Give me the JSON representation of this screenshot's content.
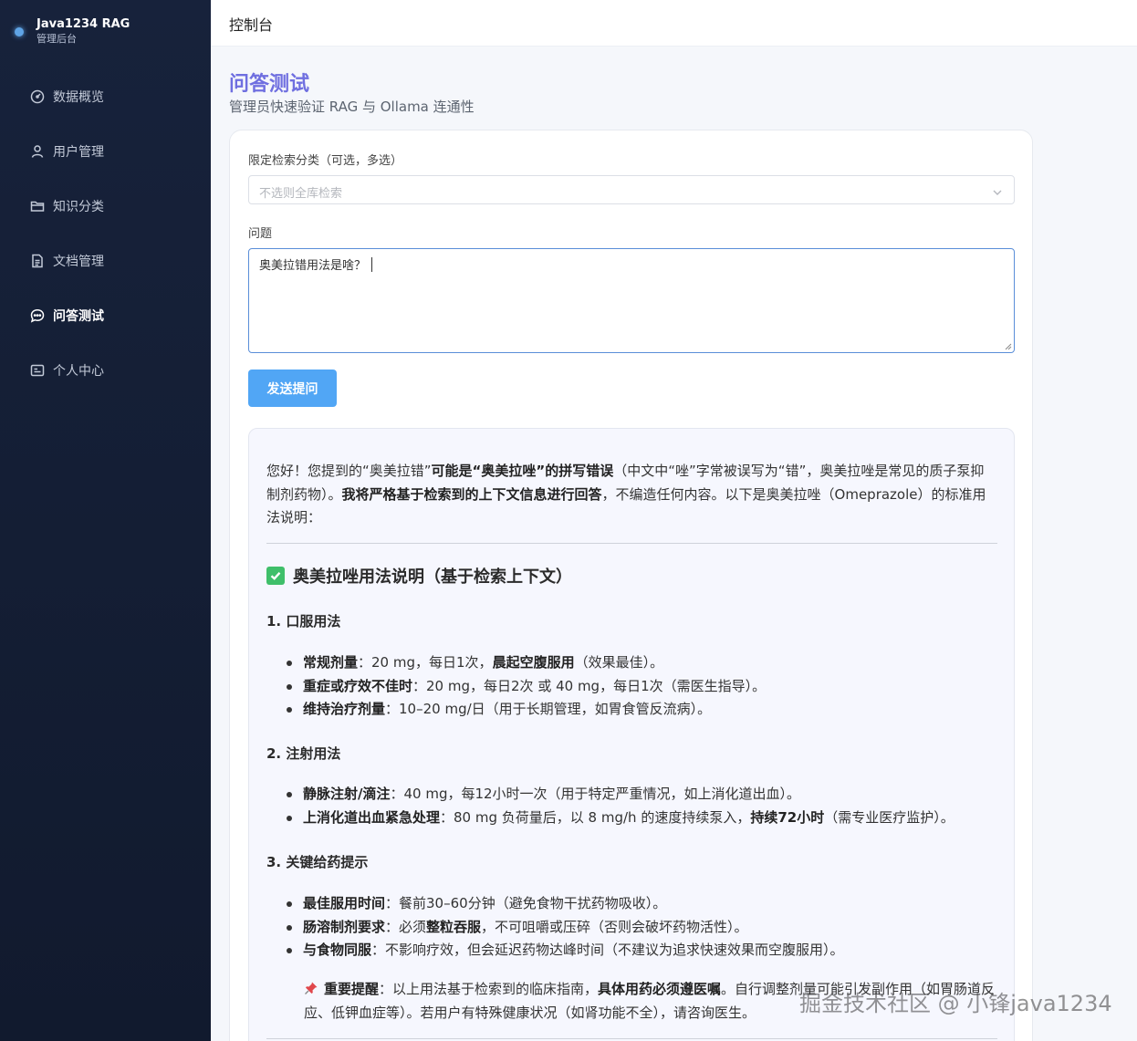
{
  "sidebar": {
    "brand_title": "Java1234 RAG",
    "brand_sub": "管理后台",
    "items": [
      {
        "label": "数据概览",
        "icon": "dashboard-icon"
      },
      {
        "label": "用户管理",
        "icon": "user-icon"
      },
      {
        "label": "知识分类",
        "icon": "folder-icon"
      },
      {
        "label": "文档管理",
        "icon": "document-icon"
      },
      {
        "label": "问答测试",
        "icon": "chat-icon",
        "active": true
      },
      {
        "label": "个人中心",
        "icon": "profile-card-icon"
      }
    ]
  },
  "header": {
    "title": "控制台"
  },
  "page": {
    "title": "问答测试",
    "subtitle": "管理员快速验证 RAG 与 Ollama 连通性"
  },
  "form": {
    "category_label": "限定检索分类（可选，多选）",
    "category_placeholder": "不选则全库检索",
    "question_label": "问题",
    "question_value": "奥美拉错用法是啥？",
    "send_label": "发送提问"
  },
  "answer": {
    "intro": {
      "t1": "您好！您提到的“奥美拉错”",
      "b1": "可能是“奥美拉唑”的拼写错误",
      "t2": "（中文中“唑”字常被误写为“错”，奥美拉唑是常见的质子泵抑制剂药物）。",
      "b2": "我将严格基于检索到的上下文信息进行回答",
      "t3": "，不编造任何内容。以下是奥美拉唑（Omeprazole）的标准用法说明："
    },
    "heading": "奥美拉唑用法说明（基于检索上下文）",
    "sections": [
      {
        "title": "1. 口服用法",
        "items": [
          {
            "bold": "常规剂量",
            "text": "：20 mg，每日1次，",
            "bold2": "晨起空腹服用",
            "text2": "（效果最佳）。"
          },
          {
            "bold": "重症或疗效不佳时",
            "text": "：20 mg，每日2次 或 40 mg，每日1次（需医生指导）。",
            "bold2": "",
            "text2": ""
          },
          {
            "bold": "维持治疗剂量",
            "text": "：10–20 mg/日（用于长期管理，如胃食管反流病）。",
            "bold2": "",
            "text2": ""
          }
        ]
      },
      {
        "title": "2. 注射用法",
        "items": [
          {
            "bold": "静脉注射/滴注",
            "text": "：40 mg，每12小时一次（用于特定严重情况，如上消化道出血）。",
            "bold2": "",
            "text2": ""
          },
          {
            "bold": "上消化道出血紧急处理",
            "text": "：80 mg 负荷量后，以 8 mg/h 的速度持续泵入，",
            "bold2": "持续72小时",
            "text2": "（需专业医疗监护）。"
          }
        ]
      },
      {
        "title": "3. 关键给药提示",
        "items": [
          {
            "bold": "最佳服用时间",
            "text": "：餐前30–60分钟（避免食物干扰药物吸收）。",
            "bold2": "",
            "text2": ""
          },
          {
            "bold": "肠溶制剂要求",
            "text": "：必须",
            "bold2": "整粒吞服",
            "text2": "，不可咀嚼或压碎（否则会破坏药物活性）。"
          },
          {
            "bold": "与食物同服",
            "text": "：不影响疗效，但会延迟药物达峰时间（不建议为追求快速效果而空腹服用）。",
            "bold2": "",
            "text2": ""
          }
        ]
      }
    ],
    "note": {
      "bold": "重要提醒",
      "t1": "：以上用法基于检索到的临床指南，",
      "bold2": "具体用药必须遵医嘱",
      "t2": "。自行调整剂量可能引发副作用（如胃肠道反应、低钾血症等）。若用户有特殊健康状况（如肾功能不全），请咨询医生。"
    }
  },
  "watermark": "掘金技术社区 @ 小锋java1234",
  "colors": {
    "sidebar_bg": "#14213d",
    "accent": "#51a6f5",
    "title": "#6f6fe0"
  }
}
